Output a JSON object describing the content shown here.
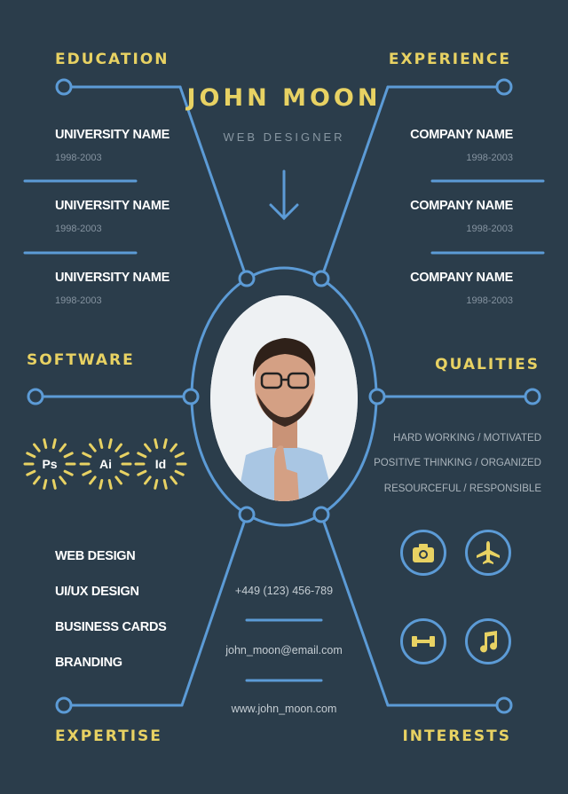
{
  "header": {
    "name": "JOHN MOON",
    "role": "WEB DESIGNER"
  },
  "sections": {
    "education": "EDUCATION",
    "experience": "EXPERIENCE",
    "software": "SOFTWARE",
    "qualities": "QUALITIES",
    "expertise": "EXPERTISE",
    "interests": "INTERESTS"
  },
  "education": [
    {
      "title": "UNIVERSITY NAME",
      "years": "1998-2003"
    },
    {
      "title": "UNIVERSITY NAME",
      "years": "1998-2003"
    },
    {
      "title": "UNIVERSITY NAME",
      "years": "1998-2003"
    }
  ],
  "experience": [
    {
      "title": "COMPANY NAME",
      "years": "1998-2003"
    },
    {
      "title": "COMPANY NAME",
      "years": "1998-2003"
    },
    {
      "title": "COMPANY NAME",
      "years": "1998-2003"
    }
  ],
  "software": [
    {
      "label": "Ps",
      "icon": "photoshop-badge"
    },
    {
      "label": "Ai",
      "icon": "illustrator-badge"
    },
    {
      "label": "Id",
      "icon": "indesign-badge"
    }
  ],
  "qualities": [
    "HARD WORKING / MOTIVATED",
    "POSITIVE THINKING / ORGANIZED",
    "RESOURCEFUL / RESPONSIBLE"
  ],
  "expertise": [
    "WEB DESIGN",
    "UI/UX DESIGN",
    "BUSINESS CARDS",
    "BRANDING"
  ],
  "contact": {
    "phone": "+449 (123) 456-789",
    "email": "john_moon@email.com",
    "website": "www.john_moon.com"
  },
  "interests": [
    {
      "icon": "camera-icon"
    },
    {
      "icon": "airplane-icon"
    },
    {
      "icon": "dumbbell-icon"
    },
    {
      "icon": "music-note-icon"
    }
  ],
  "colors": {
    "background": "#2b3d4b",
    "accent_yellow": "#e8d263",
    "line_blue": "#5c9bd6"
  }
}
